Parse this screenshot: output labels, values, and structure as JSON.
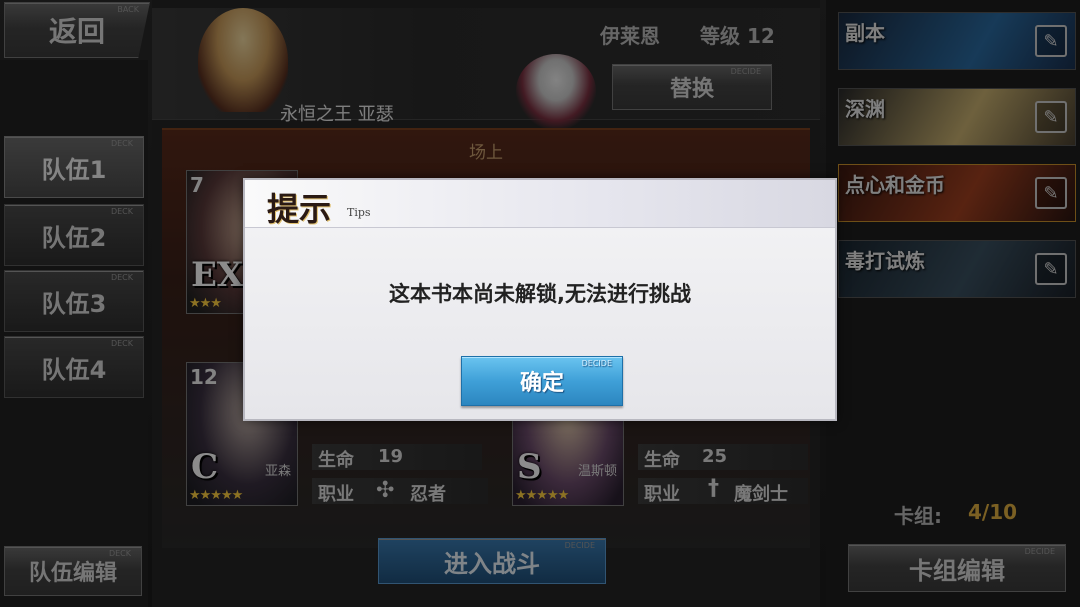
{
  "nav": {
    "back_label": "返回",
    "back_tag": "BACK"
  },
  "teams": {
    "tabs": [
      {
        "label": "队伍1",
        "tag": "DECK"
      },
      {
        "label": "队伍2",
        "tag": "DECK"
      },
      {
        "label": "队伍3",
        "tag": "DECK"
      },
      {
        "label": "队伍4",
        "tag": "DECK"
      }
    ],
    "edit_label": "队伍编辑",
    "edit_tag": "DECK"
  },
  "header": {
    "player_name": "伊莱恩",
    "level_text": "等级 12",
    "leader_name": "永恒之王 亚瑟",
    "replace_label": "替换",
    "replace_tag": "DECIDE"
  },
  "field": {
    "label": "场上",
    "cards": [
      {
        "level": "7",
        "rank": "EX",
        "stars": "★★★",
        "name": ""
      },
      {
        "level": "12",
        "rank": "C",
        "stars": "★★★★★",
        "name": "亚森"
      },
      {
        "level": "",
        "rank": "S",
        "stars": "★★★★★",
        "name": "温斯顿"
      }
    ],
    "stats": [
      {
        "hp_label": "生命",
        "hp_value": "19",
        "job_label": "职业",
        "job_value": "忍者",
        "job_icon": "ninja-star-icon"
      },
      {
        "hp_label": "生命",
        "hp_value": "25",
        "job_label": "职业",
        "job_value": "魔剑士",
        "job_icon": "sword-icon"
      }
    ],
    "start_label": "进入战斗",
    "start_tag": "DECIDE"
  },
  "modes": [
    {
      "label": "副本",
      "color": "#2a6aa0"
    },
    {
      "label": "深渊",
      "color": "#c8b070"
    },
    {
      "label": "点心和金币",
      "color": "#a04020"
    },
    {
      "label": "毒打试炼",
      "color": "#3a5060"
    }
  ],
  "deck": {
    "count_label": "卡组:",
    "count_value": "4/10",
    "edit_label": "卡组编辑",
    "edit_tag": "DECIDE"
  },
  "dialog": {
    "title": "提示",
    "subtitle": "Tips",
    "message": "这本书本尚未解锁,无法进行挑战",
    "confirm_label": "确定",
    "confirm_tag": "DECIDE"
  }
}
